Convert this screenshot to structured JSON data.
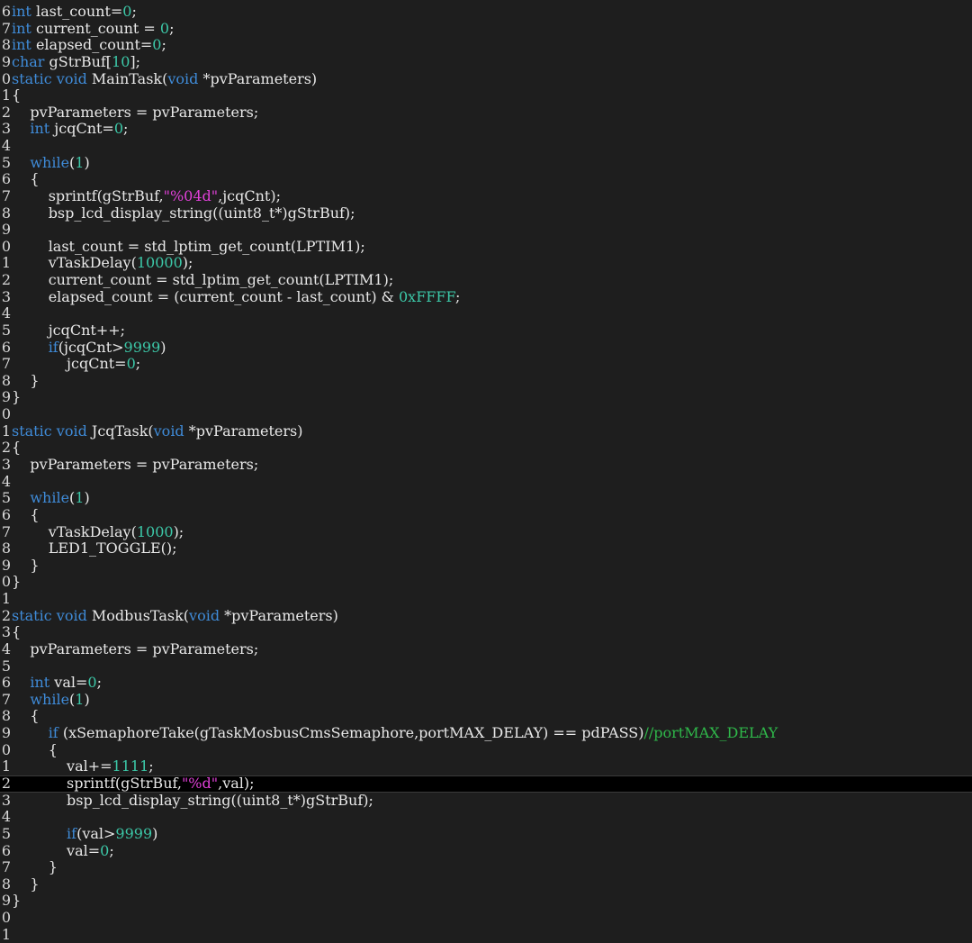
{
  "colors": {
    "background": "#1e1e1e",
    "current_line": "#000000",
    "keyword": "#3f8bd8",
    "number": "#3cc8a8",
    "string": "#e040d8",
    "comment": "#2fb84a",
    "text": "#e8e8e8"
  },
  "editor": {
    "current_line_index": 46,
    "lines": [
      {
        "n": "6",
        "tokens": [
          [
            "kw",
            "int"
          ],
          [
            "pl",
            " last_count="
          ],
          [
            "num",
            "0"
          ],
          [
            "pl",
            ";"
          ]
        ]
      },
      {
        "n": "7",
        "tokens": [
          [
            "kw",
            "int"
          ],
          [
            "pl",
            " current_count = "
          ],
          [
            "num",
            "0"
          ],
          [
            "pl",
            ";"
          ]
        ]
      },
      {
        "n": "8",
        "tokens": [
          [
            "kw",
            "int"
          ],
          [
            "pl",
            " elapsed_count="
          ],
          [
            "num",
            "0"
          ],
          [
            "pl",
            ";"
          ]
        ]
      },
      {
        "n": "9",
        "tokens": [
          [
            "kw",
            "char"
          ],
          [
            "pl",
            " gStrBuf["
          ],
          [
            "num",
            "10"
          ],
          [
            "pl",
            "];"
          ]
        ]
      },
      {
        "n": "0",
        "tokens": [
          [
            "kw",
            "static void"
          ],
          [
            "pl",
            " MainTask("
          ],
          [
            "kw",
            "void"
          ],
          [
            "pl",
            " *pvParameters)"
          ]
        ]
      },
      {
        "n": "1",
        "tokens": [
          [
            "pl",
            "{"
          ]
        ]
      },
      {
        "n": "2",
        "tokens": [
          [
            "pl",
            "    pvParameters = pvParameters;"
          ]
        ]
      },
      {
        "n": "3",
        "tokens": [
          [
            "pl",
            "    "
          ],
          [
            "kw",
            "int"
          ],
          [
            "pl",
            " jcqCnt="
          ],
          [
            "num",
            "0"
          ],
          [
            "pl",
            ";"
          ]
        ]
      },
      {
        "n": "4",
        "tokens": []
      },
      {
        "n": "5",
        "tokens": [
          [
            "pl",
            "    "
          ],
          [
            "kw",
            "while"
          ],
          [
            "pl",
            "("
          ],
          [
            "num",
            "1"
          ],
          [
            "pl",
            ")"
          ]
        ]
      },
      {
        "n": "6",
        "tokens": [
          [
            "pl",
            "    {"
          ]
        ]
      },
      {
        "n": "7",
        "tokens": [
          [
            "pl",
            "        sprintf(gStrBuf,"
          ],
          [
            "str",
            "\"%04d\""
          ],
          [
            "pl",
            ",jcqCnt);"
          ]
        ]
      },
      {
        "n": "8",
        "tokens": [
          [
            "pl",
            "        bsp_lcd_display_string((uint8_t*)gStrBuf);"
          ]
        ]
      },
      {
        "n": "9",
        "tokens": []
      },
      {
        "n": "0",
        "tokens": [
          [
            "pl",
            "        last_count = std_lptim_get_count(LPTIM1);"
          ]
        ]
      },
      {
        "n": "1",
        "tokens": [
          [
            "pl",
            "        vTaskDelay("
          ],
          [
            "num",
            "10000"
          ],
          [
            "pl",
            ");"
          ]
        ]
      },
      {
        "n": "2",
        "tokens": [
          [
            "pl",
            "        current_count = std_lptim_get_count(LPTIM1);"
          ]
        ]
      },
      {
        "n": "3",
        "tokens": [
          [
            "pl",
            "        elapsed_count = (current_count - last_count) & "
          ],
          [
            "num",
            "0xFFFF"
          ],
          [
            "pl",
            ";"
          ]
        ]
      },
      {
        "n": "4",
        "tokens": []
      },
      {
        "n": "5",
        "tokens": [
          [
            "pl",
            "        jcqCnt++;"
          ]
        ]
      },
      {
        "n": "6",
        "tokens": [
          [
            "pl",
            "        "
          ],
          [
            "kw",
            "if"
          ],
          [
            "pl",
            "(jcqCnt>"
          ],
          [
            "num",
            "9999"
          ],
          [
            "pl",
            ")"
          ]
        ]
      },
      {
        "n": "7",
        "tokens": [
          [
            "pl",
            "            jcqCnt="
          ],
          [
            "num",
            "0"
          ],
          [
            "pl",
            ";"
          ]
        ]
      },
      {
        "n": "8",
        "tokens": [
          [
            "pl",
            "    }"
          ]
        ]
      },
      {
        "n": "9",
        "tokens": [
          [
            "pl",
            "}"
          ]
        ]
      },
      {
        "n": "0",
        "tokens": []
      },
      {
        "n": "1",
        "tokens": [
          [
            "kw",
            "static void"
          ],
          [
            "pl",
            " JcqTask("
          ],
          [
            "kw",
            "void"
          ],
          [
            "pl",
            " *pvParameters)"
          ]
        ]
      },
      {
        "n": "2",
        "tokens": [
          [
            "pl",
            "{"
          ]
        ]
      },
      {
        "n": "3",
        "tokens": [
          [
            "pl",
            "    pvParameters = pvParameters;"
          ]
        ]
      },
      {
        "n": "4",
        "tokens": []
      },
      {
        "n": "5",
        "tokens": [
          [
            "pl",
            "    "
          ],
          [
            "kw",
            "while"
          ],
          [
            "pl",
            "("
          ],
          [
            "num",
            "1"
          ],
          [
            "pl",
            ")"
          ]
        ]
      },
      {
        "n": "6",
        "tokens": [
          [
            "pl",
            "    {"
          ]
        ]
      },
      {
        "n": "7",
        "tokens": [
          [
            "pl",
            "        vTaskDelay("
          ],
          [
            "num",
            "1000"
          ],
          [
            "pl",
            ");"
          ]
        ]
      },
      {
        "n": "8",
        "tokens": [
          [
            "pl",
            "        LED1_TOGGLE();"
          ]
        ]
      },
      {
        "n": "9",
        "tokens": [
          [
            "pl",
            "    }"
          ]
        ]
      },
      {
        "n": "0",
        "tokens": [
          [
            "pl",
            "}"
          ]
        ]
      },
      {
        "n": "1",
        "tokens": []
      },
      {
        "n": "2",
        "tokens": [
          [
            "kw",
            "static void"
          ],
          [
            "pl",
            " ModbusTask("
          ],
          [
            "kw",
            "void"
          ],
          [
            "pl",
            " *pvParameters)"
          ]
        ]
      },
      {
        "n": "3",
        "tokens": [
          [
            "pl",
            "{"
          ]
        ]
      },
      {
        "n": "4",
        "tokens": [
          [
            "pl",
            "    pvParameters = pvParameters;"
          ]
        ]
      },
      {
        "n": "5",
        "tokens": []
      },
      {
        "n": "6",
        "tokens": [
          [
            "pl",
            "    "
          ],
          [
            "kw",
            "int"
          ],
          [
            "pl",
            " val="
          ],
          [
            "num",
            "0"
          ],
          [
            "pl",
            ";"
          ]
        ]
      },
      {
        "n": "7",
        "tokens": [
          [
            "pl",
            "    "
          ],
          [
            "kw",
            "while"
          ],
          [
            "pl",
            "("
          ],
          [
            "num",
            "1"
          ],
          [
            "pl",
            ")"
          ]
        ]
      },
      {
        "n": "8",
        "tokens": [
          [
            "pl",
            "    {"
          ]
        ]
      },
      {
        "n": "9",
        "tokens": [
          [
            "pl",
            "        "
          ],
          [
            "kw",
            "if"
          ],
          [
            "pl",
            " (xSemaphoreTake(gTaskMosbusCmsSemaphore,portMAX_DELAY) == pdPASS)"
          ],
          [
            "cmt",
            "//portMAX_DELAY"
          ]
        ]
      },
      {
        "n": "0",
        "tokens": [
          [
            "pl",
            "        {"
          ]
        ]
      },
      {
        "n": "1",
        "tokens": [
          [
            "pl",
            "            val+="
          ],
          [
            "num",
            "1111"
          ],
          [
            "pl",
            ";"
          ]
        ]
      },
      {
        "n": "2",
        "tokens": [
          [
            "pl",
            "            sprintf(gStrBuf,"
          ],
          [
            "str",
            "\"%d\""
          ],
          [
            "pl",
            ",val);"
          ]
        ]
      },
      {
        "n": "3",
        "tokens": [
          [
            "pl",
            "            bsp_lcd_display_string((uint8_t*)gStrBuf);"
          ]
        ]
      },
      {
        "n": "4",
        "tokens": []
      },
      {
        "n": "5",
        "tokens": [
          [
            "pl",
            "            "
          ],
          [
            "kw",
            "if"
          ],
          [
            "pl",
            "(val>"
          ],
          [
            "num",
            "9999"
          ],
          [
            "pl",
            ")"
          ]
        ]
      },
      {
        "n": "6",
        "tokens": [
          [
            "pl",
            "            val="
          ],
          [
            "num",
            "0"
          ],
          [
            "pl",
            ";"
          ]
        ]
      },
      {
        "n": "7",
        "tokens": [
          [
            "pl",
            "        }"
          ]
        ]
      },
      {
        "n": "8",
        "tokens": [
          [
            "pl",
            "    }"
          ]
        ]
      },
      {
        "n": "9",
        "tokens": [
          [
            "pl",
            "}"
          ]
        ]
      },
      {
        "n": "0",
        "tokens": []
      },
      {
        "n": "1",
        "tokens": []
      }
    ]
  }
}
